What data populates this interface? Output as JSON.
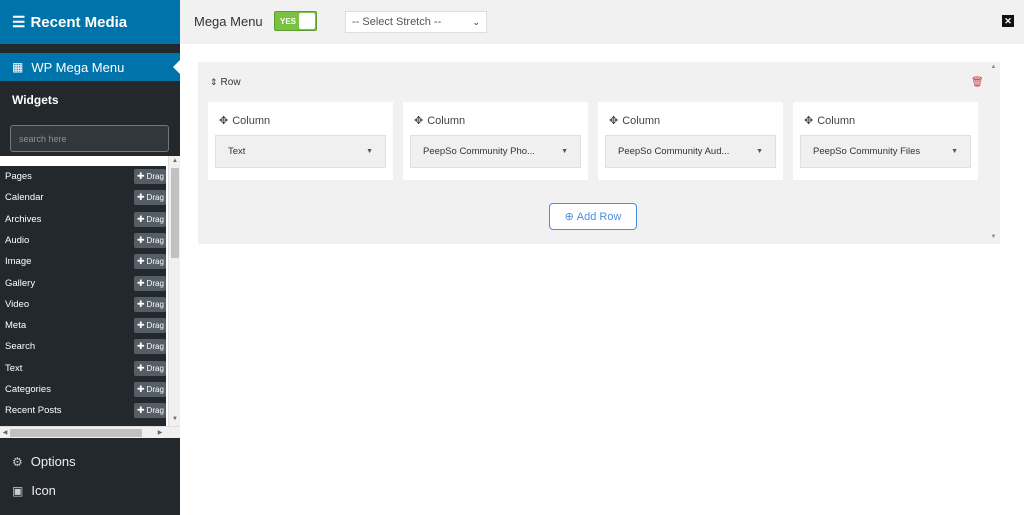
{
  "sidebar": {
    "title": "Recent Media",
    "active_item": "WP Mega Menu",
    "widgets_heading": "Widgets",
    "search_placeholder": "search here",
    "drag_label": "Drag",
    "widgets": [
      "Pages",
      "Calendar",
      "Archives",
      "Audio",
      "Image",
      "Gallery",
      "Video",
      "Meta",
      "Search",
      "Text",
      "Categories",
      "Recent Posts"
    ],
    "bottom_items": [
      {
        "label": "Options",
        "icon": "gear-icon"
      },
      {
        "label": "Icon",
        "icon": "cube-icon"
      }
    ]
  },
  "topbar": {
    "mega_menu_label": "Mega Menu",
    "toggle_text": "YES",
    "stretch_select": "-- Select Stretch --",
    "close_symbol": "✕"
  },
  "builder": {
    "row_label": "Row",
    "columns": [
      {
        "title": "Column",
        "widget": "Text"
      },
      {
        "title": "Column",
        "widget": "PeepSo Community Pho..."
      },
      {
        "title": "Column",
        "widget": "PeepSo Community Aud..."
      },
      {
        "title": "Column",
        "widget": "PeepSo Community Files"
      }
    ],
    "add_row_label": "Add Row"
  },
  "colors": {
    "primary": "#0073aa",
    "sidebar_bg": "#23282d",
    "toggle_on": "#7ac142",
    "add_row": "#4a90e2",
    "delete": "#dd3333"
  }
}
